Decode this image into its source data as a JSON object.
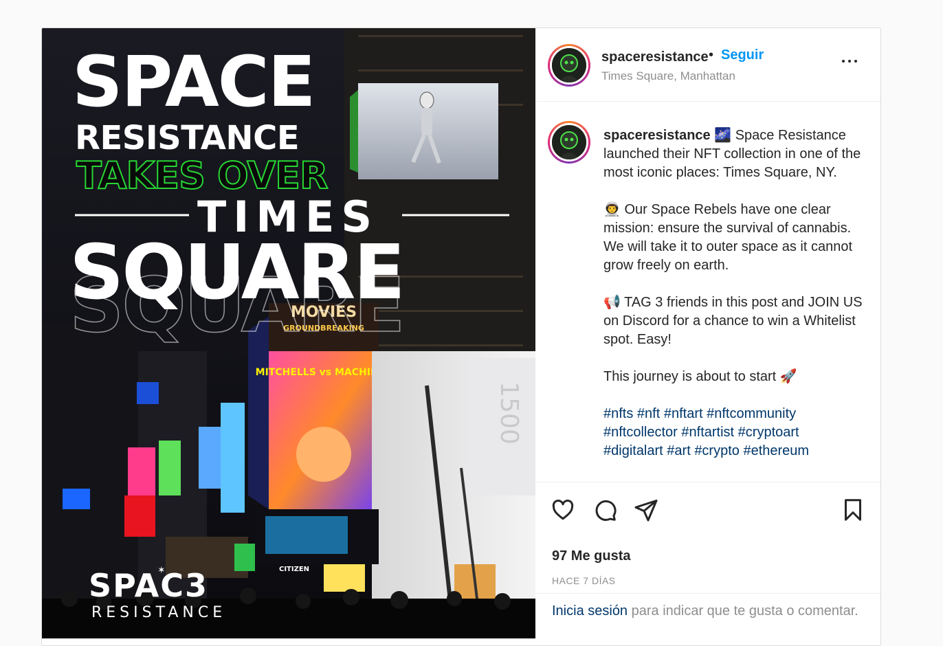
{
  "post": {
    "image": {
      "headline": {
        "line1": "SPACE",
        "line2": "RESISTANCE",
        "line3": "TAKES OVER",
        "line4": "TIMES",
        "line5": "SQUARE"
      },
      "logo": {
        "top": "SPAC3",
        "bottom": "RESISTANCE"
      },
      "billboards": {
        "movies": "MOVIES",
        "groundbreaking": "GROUNDBREAKING",
        "mitchells": "MITCHELLS vs MACHINES",
        "citizen": "CITIZEN",
        "building_number": "1500"
      }
    },
    "header": {
      "username": "spaceresistance",
      "separator": "•",
      "follow_label": "Seguir",
      "location": "Times Square, Manhattan"
    },
    "caption": {
      "username": "spaceresistance",
      "intro_icon": "🌌",
      "intro": "Space Resistance launched their NFT collection in one of the most iconic places: Times Square, NY.",
      "para2_icon": "👨‍🚀",
      "para2": "Our Space Rebels have one clear mission: ensure the survival of cannabis. We will take it to outer space as it cannot grow freely on earth.",
      "para3_icon": "📢",
      "para3": "TAG 3 friends in this post and JOIN US on Discord for a chance to win a Whitelist spot. Easy!",
      "para4": "This journey is about to start",
      "para4_icon": "🚀",
      "hashtags": [
        "#nfts",
        "#nft",
        "#nftart",
        "#nftcommunity",
        "#nftcollector",
        "#nftartist",
        "#cryptoart",
        "#digitalart",
        "#art",
        "#crypto",
        "#ethereum"
      ]
    },
    "actions": {
      "icons": [
        "heart-icon",
        "comment-icon",
        "share-icon",
        "bookmark-icon"
      ]
    },
    "likes": "97 Me gusta",
    "timestamp": "HACE 7 DÍAS",
    "login_prompt": {
      "link": "Inicia sesión",
      "rest": " para indicar que te gusta o comentar."
    }
  },
  "colors": {
    "follow": "#0095f6",
    "hashtag": "#00376b",
    "secondary_text": "#8e8e8e",
    "neon_green": "#27d633"
  }
}
